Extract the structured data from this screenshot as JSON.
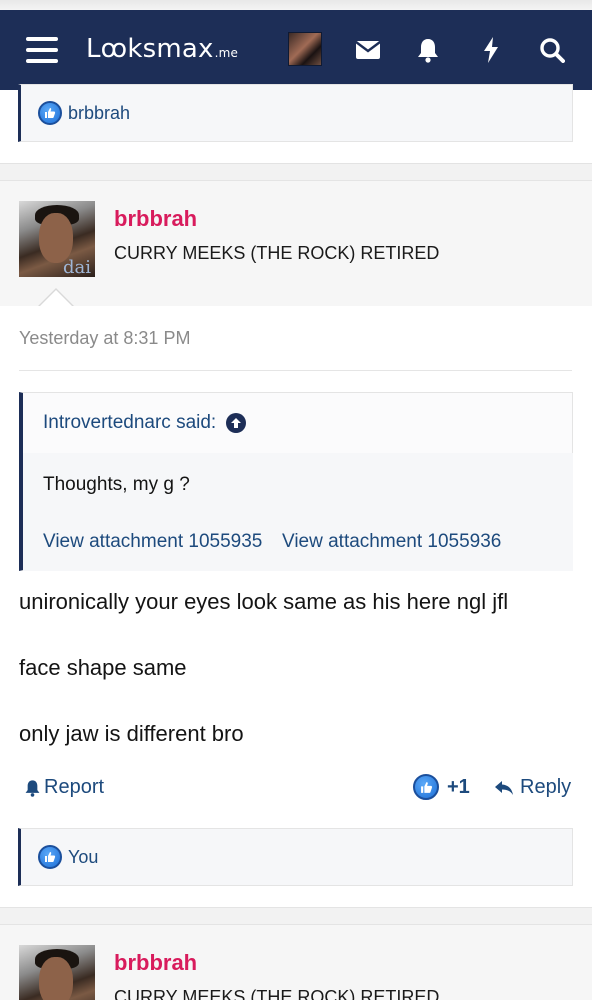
{
  "navbar": {
    "logo_main": "Lꝏksmax",
    "logo_suffix": ".me",
    "colors": {
      "background": "#1d2e57",
      "icon": "#ffffff"
    },
    "icons": [
      "menu-icon",
      "avatar",
      "mail-icon",
      "bell-icon",
      "bolt-icon",
      "search-icon"
    ]
  },
  "previous_post": {
    "reactions_label": "brbbrah"
  },
  "post": {
    "username": "brbbrah",
    "user_title": "CURRY MEEKS (THE ROCK) RETIRED",
    "timestamp": "Yesterday at 8:31 PM",
    "quote": {
      "author_line": "Introvertednarc said:",
      "text": "Thoughts, my g ?",
      "attachments": [
        "View attachment 1055935",
        "View attachment 1055936"
      ]
    },
    "body": [
      "unironically your eyes look same as his here ngl jfl",
      "face shape same",
      "only jaw is different bro"
    ],
    "actions": {
      "report": "Report",
      "like_count": "+1",
      "reply": "Reply"
    },
    "reactions_label": "You",
    "colors": {
      "username": "#d81b5c",
      "link": "#1d4a7d"
    }
  },
  "next_post": {
    "username": "brbbrah",
    "user_title": "CURRY MEEKS (THE ROCK) RETIRED"
  }
}
